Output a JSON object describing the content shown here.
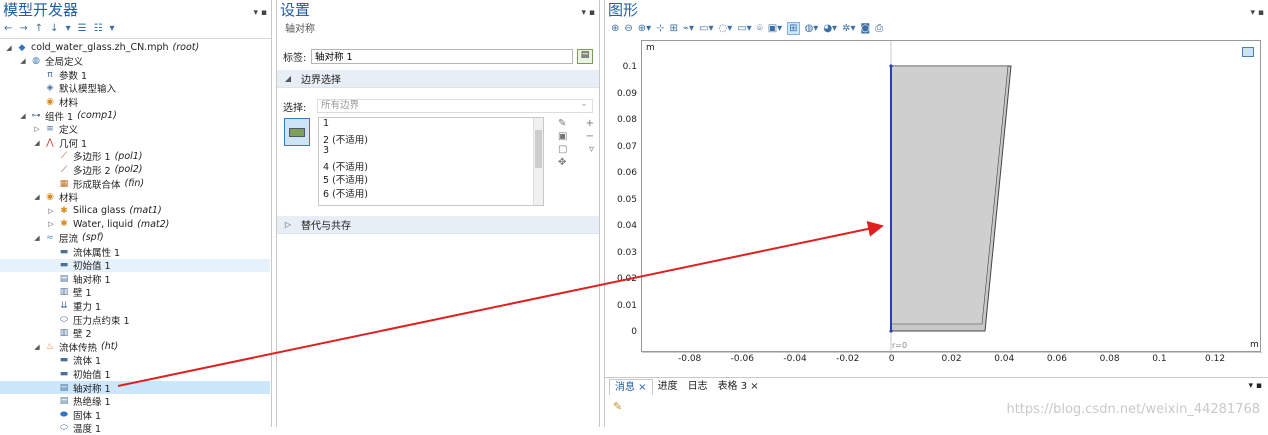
{
  "model_builder": {
    "title": "模型开发器",
    "tree": [
      {
        "depth": 0,
        "toggle": "◢",
        "icon": "model-icon",
        "label": "cold_water_glass.zh_CN.mph",
        "tag": "(root)"
      },
      {
        "depth": 1,
        "toggle": "◢",
        "icon": "globe-icon",
        "label": "全局定义",
        "tag": ""
      },
      {
        "depth": 2,
        "toggle": "",
        "icon": "parameters-icon",
        "label": "参数 1",
        "tag": ""
      },
      {
        "depth": 2,
        "toggle": "",
        "icon": "default-input-icon",
        "label": "默认模型输入",
        "tag": ""
      },
      {
        "depth": 2,
        "toggle": "",
        "icon": "materials-icon",
        "label": "材料",
        "tag": ""
      },
      {
        "depth": 1,
        "toggle": "◢",
        "icon": "component-icon",
        "label": "组件 1",
        "tag": "(comp1)"
      },
      {
        "depth": 2,
        "toggle": "▷",
        "icon": "definitions-icon",
        "label": "定义",
        "tag": ""
      },
      {
        "depth": 2,
        "toggle": "◢",
        "icon": "geometry-icon",
        "label": "几何 1",
        "tag": ""
      },
      {
        "depth": 3,
        "toggle": "",
        "icon": "polygon-icon",
        "label": "多边形 1",
        "tag": "(pol1)"
      },
      {
        "depth": 3,
        "toggle": "",
        "icon": "polygon-icon",
        "label": "多边形 2",
        "tag": "(pol2)"
      },
      {
        "depth": 3,
        "toggle": "",
        "icon": "form-union-icon",
        "label": "形成联合体",
        "tag": "(fin)"
      },
      {
        "depth": 2,
        "toggle": "◢",
        "icon": "materials-icon",
        "label": "材料",
        "tag": ""
      },
      {
        "depth": 3,
        "toggle": "▷",
        "icon": "material-icon",
        "label": "Silica glass",
        "tag": "(mat1)"
      },
      {
        "depth": 3,
        "toggle": "▷",
        "icon": "material-icon",
        "label": "Water, liquid",
        "tag": "(mat2)"
      },
      {
        "depth": 2,
        "toggle": "◢",
        "icon": "laminar-flow-icon",
        "label": "层流",
        "tag": "(spf)"
      },
      {
        "depth": 3,
        "toggle": "",
        "icon": "fluid-properties-icon",
        "label": "流体属性 1",
        "tag": ""
      },
      {
        "depth": 3,
        "toggle": "",
        "icon": "initial-values-icon",
        "label": "初始值 1",
        "tag": ""
      },
      {
        "depth": 3,
        "toggle": "",
        "icon": "axial-symmetry-icon",
        "label": "轴对称 1",
        "tag": ""
      },
      {
        "depth": 3,
        "toggle": "",
        "icon": "wall-icon",
        "label": "壁 1",
        "tag": ""
      },
      {
        "depth": 3,
        "toggle": "",
        "icon": "gravity-icon",
        "label": "重力 1",
        "tag": ""
      },
      {
        "depth": 3,
        "toggle": "",
        "icon": "pressure-point-icon",
        "label": "压力点约束 1",
        "tag": ""
      },
      {
        "depth": 3,
        "toggle": "",
        "icon": "wall-icon",
        "label": "壁 2",
        "tag": ""
      },
      {
        "depth": 2,
        "toggle": "◢",
        "icon": "heat-transfer-icon",
        "label": "流体传热",
        "tag": "(ht)"
      },
      {
        "depth": 3,
        "toggle": "",
        "icon": "fluid-icon",
        "label": "流体 1",
        "tag": ""
      },
      {
        "depth": 3,
        "toggle": "",
        "icon": "initial-values-icon",
        "label": "初始值 1",
        "tag": ""
      },
      {
        "depth": 3,
        "toggle": "",
        "icon": "axial-symmetry-icon",
        "label": "轴对称 1",
        "tag": ""
      },
      {
        "depth": 3,
        "toggle": "",
        "icon": "thermal-insulation-icon",
        "label": "热绝缘 1",
        "tag": ""
      },
      {
        "depth": 3,
        "toggle": "",
        "icon": "solid-icon",
        "label": "固体 1",
        "tag": ""
      },
      {
        "depth": 3,
        "toggle": "",
        "icon": "temperature-icon",
        "label": "温度 1",
        "tag": ""
      }
    ]
  },
  "settings": {
    "title": "设置",
    "subtitle": "轴对称",
    "label_caption": "标签:",
    "label_value": "轴对称 1",
    "boundary_section": "边界选择",
    "selection_caption": "选择:",
    "selection_value": "所有边界",
    "boundaries": [
      "1",
      "2 (不适用)",
      "3",
      "4 (不适用)",
      "5 (不适用)",
      "6 (不适用)"
    ],
    "override_section": "替代与共存"
  },
  "graphics": {
    "title": "图形",
    "unit_label": "m",
    "x_ticks": [
      "-0.08",
      "-0.06",
      "-0.04",
      "-0.02",
      "0",
      "0.02",
      "0.04",
      "0.06",
      "0.08",
      "0.1",
      "0.12"
    ],
    "y_ticks": [
      "0.1",
      "0.09",
      "0.08",
      "0.07",
      "0.06",
      "0.05",
      "0.04",
      "0.03",
      "0.02",
      "0.01",
      "0"
    ],
    "axis_label": "r=0",
    "x_unit": "m",
    "tabs": [
      "消息",
      "进度",
      "日志",
      "表格 3"
    ],
    "watermark": "https://blog.csdn.net/weixin_44281768"
  }
}
